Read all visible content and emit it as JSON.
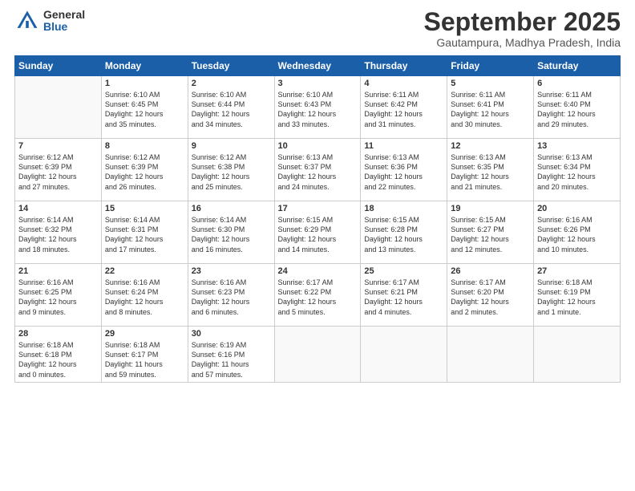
{
  "header": {
    "logo_general": "General",
    "logo_blue": "Blue",
    "month_title": "September 2025",
    "location": "Gautampura, Madhya Pradesh, India"
  },
  "days_of_week": [
    "Sunday",
    "Monday",
    "Tuesday",
    "Wednesday",
    "Thursday",
    "Friday",
    "Saturday"
  ],
  "weeks": [
    [
      {
        "day": "",
        "info": ""
      },
      {
        "day": "1",
        "info": "Sunrise: 6:10 AM\nSunset: 6:45 PM\nDaylight: 12 hours\nand 35 minutes."
      },
      {
        "day": "2",
        "info": "Sunrise: 6:10 AM\nSunset: 6:44 PM\nDaylight: 12 hours\nand 34 minutes."
      },
      {
        "day": "3",
        "info": "Sunrise: 6:10 AM\nSunset: 6:43 PM\nDaylight: 12 hours\nand 33 minutes."
      },
      {
        "day": "4",
        "info": "Sunrise: 6:11 AM\nSunset: 6:42 PM\nDaylight: 12 hours\nand 31 minutes."
      },
      {
        "day": "5",
        "info": "Sunrise: 6:11 AM\nSunset: 6:41 PM\nDaylight: 12 hours\nand 30 minutes."
      },
      {
        "day": "6",
        "info": "Sunrise: 6:11 AM\nSunset: 6:40 PM\nDaylight: 12 hours\nand 29 minutes."
      }
    ],
    [
      {
        "day": "7",
        "info": "Sunrise: 6:12 AM\nSunset: 6:39 PM\nDaylight: 12 hours\nand 27 minutes."
      },
      {
        "day": "8",
        "info": "Sunrise: 6:12 AM\nSunset: 6:39 PM\nDaylight: 12 hours\nand 26 minutes."
      },
      {
        "day": "9",
        "info": "Sunrise: 6:12 AM\nSunset: 6:38 PM\nDaylight: 12 hours\nand 25 minutes."
      },
      {
        "day": "10",
        "info": "Sunrise: 6:13 AM\nSunset: 6:37 PM\nDaylight: 12 hours\nand 24 minutes."
      },
      {
        "day": "11",
        "info": "Sunrise: 6:13 AM\nSunset: 6:36 PM\nDaylight: 12 hours\nand 22 minutes."
      },
      {
        "day": "12",
        "info": "Sunrise: 6:13 AM\nSunset: 6:35 PM\nDaylight: 12 hours\nand 21 minutes."
      },
      {
        "day": "13",
        "info": "Sunrise: 6:13 AM\nSunset: 6:34 PM\nDaylight: 12 hours\nand 20 minutes."
      }
    ],
    [
      {
        "day": "14",
        "info": "Sunrise: 6:14 AM\nSunset: 6:32 PM\nDaylight: 12 hours\nand 18 minutes."
      },
      {
        "day": "15",
        "info": "Sunrise: 6:14 AM\nSunset: 6:31 PM\nDaylight: 12 hours\nand 17 minutes."
      },
      {
        "day": "16",
        "info": "Sunrise: 6:14 AM\nSunset: 6:30 PM\nDaylight: 12 hours\nand 16 minutes."
      },
      {
        "day": "17",
        "info": "Sunrise: 6:15 AM\nSunset: 6:29 PM\nDaylight: 12 hours\nand 14 minutes."
      },
      {
        "day": "18",
        "info": "Sunrise: 6:15 AM\nSunset: 6:28 PM\nDaylight: 12 hours\nand 13 minutes."
      },
      {
        "day": "19",
        "info": "Sunrise: 6:15 AM\nSunset: 6:27 PM\nDaylight: 12 hours\nand 12 minutes."
      },
      {
        "day": "20",
        "info": "Sunrise: 6:16 AM\nSunset: 6:26 PM\nDaylight: 12 hours\nand 10 minutes."
      }
    ],
    [
      {
        "day": "21",
        "info": "Sunrise: 6:16 AM\nSunset: 6:25 PM\nDaylight: 12 hours\nand 9 minutes."
      },
      {
        "day": "22",
        "info": "Sunrise: 6:16 AM\nSunset: 6:24 PM\nDaylight: 12 hours\nand 8 minutes."
      },
      {
        "day": "23",
        "info": "Sunrise: 6:16 AM\nSunset: 6:23 PM\nDaylight: 12 hours\nand 6 minutes."
      },
      {
        "day": "24",
        "info": "Sunrise: 6:17 AM\nSunset: 6:22 PM\nDaylight: 12 hours\nand 5 minutes."
      },
      {
        "day": "25",
        "info": "Sunrise: 6:17 AM\nSunset: 6:21 PM\nDaylight: 12 hours\nand 4 minutes."
      },
      {
        "day": "26",
        "info": "Sunrise: 6:17 AM\nSunset: 6:20 PM\nDaylight: 12 hours\nand 2 minutes."
      },
      {
        "day": "27",
        "info": "Sunrise: 6:18 AM\nSunset: 6:19 PM\nDaylight: 12 hours\nand 1 minute."
      }
    ],
    [
      {
        "day": "28",
        "info": "Sunrise: 6:18 AM\nSunset: 6:18 PM\nDaylight: 12 hours\nand 0 minutes."
      },
      {
        "day": "29",
        "info": "Sunrise: 6:18 AM\nSunset: 6:17 PM\nDaylight: 11 hours\nand 59 minutes."
      },
      {
        "day": "30",
        "info": "Sunrise: 6:19 AM\nSunset: 6:16 PM\nDaylight: 11 hours\nand 57 minutes."
      },
      {
        "day": "",
        "info": ""
      },
      {
        "day": "",
        "info": ""
      },
      {
        "day": "",
        "info": ""
      },
      {
        "day": "",
        "info": ""
      }
    ]
  ]
}
